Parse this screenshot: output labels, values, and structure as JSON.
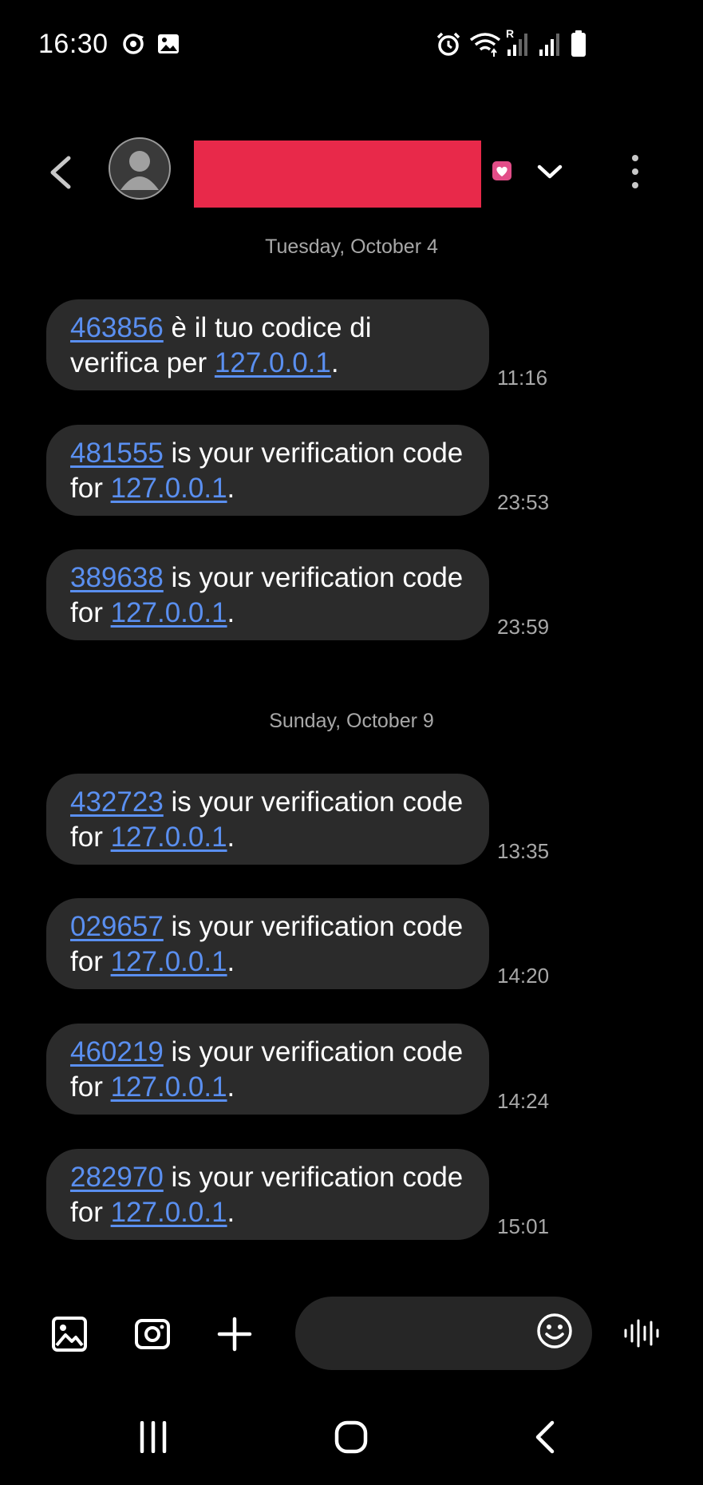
{
  "status_bar": {
    "time": "16:30",
    "left_icons": [
      "sync-icon",
      "image-notification-icon"
    ],
    "right_icons": [
      "alarm-icon",
      "wifi-icon",
      "signal-roaming-icon",
      "signal-icon",
      "battery-icon"
    ],
    "roaming_label": "R"
  },
  "header": {
    "contact_name": "",
    "icons": [
      "back-arrow-icon",
      "avatar",
      "heart-badge-icon",
      "chevron-down-icon",
      "more-vert-icon"
    ]
  },
  "conversation": {
    "groups": [
      {
        "date": "Tuesday, October 4",
        "messages": [
          {
            "code": "463856",
            "text_mid": " è il tuo codice di verifica per ",
            "link": "127.0.0.1",
            "text_end": ".",
            "time": "11:16"
          },
          {
            "code": "481555",
            "text_mid": " is your verification code for ",
            "link": "127.0.0.1",
            "text_end": ".",
            "time": "23:53"
          },
          {
            "code": "389638",
            "text_mid": " is your verification code for ",
            "link": "127.0.0.1",
            "text_end": ".",
            "time": "23:59"
          }
        ]
      },
      {
        "date": "Sunday, October 9",
        "messages": [
          {
            "code": "432723",
            "text_mid": " is your verification code for ",
            "link": "127.0.0.1",
            "text_end": ".",
            "time": "13:35"
          },
          {
            "code": "029657",
            "text_mid": " is your verification code for ",
            "link": "127.0.0.1",
            "text_end": ".",
            "time": "14:20"
          },
          {
            "code": "460219",
            "text_mid": " is your verification code for ",
            "link": "127.0.0.1",
            "text_end": ".",
            "time": "14:24"
          },
          {
            "code": "282970",
            "text_mid": " is your verification code for ",
            "link": "127.0.0.1",
            "text_end": ".",
            "time": "15:01"
          }
        ]
      }
    ]
  },
  "composer": {
    "input_value": "",
    "icons": [
      "gallery-icon",
      "camera-icon",
      "add-icon",
      "emoji-icon",
      "voice-input-icon"
    ]
  },
  "nav_bar": {
    "icons": [
      "recent-apps-icon",
      "home-icon",
      "back-icon"
    ]
  },
  "colors": {
    "background": "#000000",
    "bubble": "#2b2b2b",
    "link": "#5a8ff0",
    "redaction": "#e8294a",
    "badge": "#e24d88",
    "secondary_text": "#a8a8a8"
  }
}
